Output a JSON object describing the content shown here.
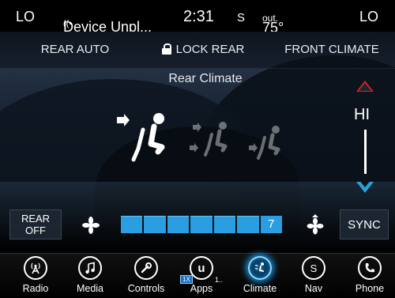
{
  "status_bar": {
    "left_temp": "LO",
    "device": "Device Unpl...",
    "time": "2:31",
    "mode": "S",
    "outside_temp": "75°",
    "outside_unit": "out.",
    "right_temp": "LO"
  },
  "tabs": {
    "rear_auto": "REAR AUTO",
    "lock_rear": "LOCK REAR",
    "front_climate": "FRONT CLIMATE"
  },
  "title": "Rear Climate",
  "temperature": {
    "value": "HI"
  },
  "fan": {
    "rear_off_line1": "REAR",
    "rear_off_line2": "OFF",
    "level": "7",
    "level_fraction": 1.0,
    "sync": "SYNC"
  },
  "nav": {
    "radio": "Radio",
    "media": "Media",
    "controls": "Controls",
    "apps": "Apps",
    "apps_badge": "1X",
    "apps_more": "1..",
    "climate": "Climate",
    "nav": "Nav",
    "phone": "Phone"
  },
  "colors": {
    "accent_blue": "#2a9ee0",
    "temp_up_red": "#dd2222",
    "temp_down_blue": "#2aa0d8"
  },
  "icons": {
    "radio": "radio-antenna-icon",
    "media": "music-note-icon",
    "controls": "wrench-icon",
    "apps": "uconnect-apps-icon",
    "climate": "climate-icon",
    "nav": "compass-s-icon",
    "phone": "phone-icon"
  }
}
